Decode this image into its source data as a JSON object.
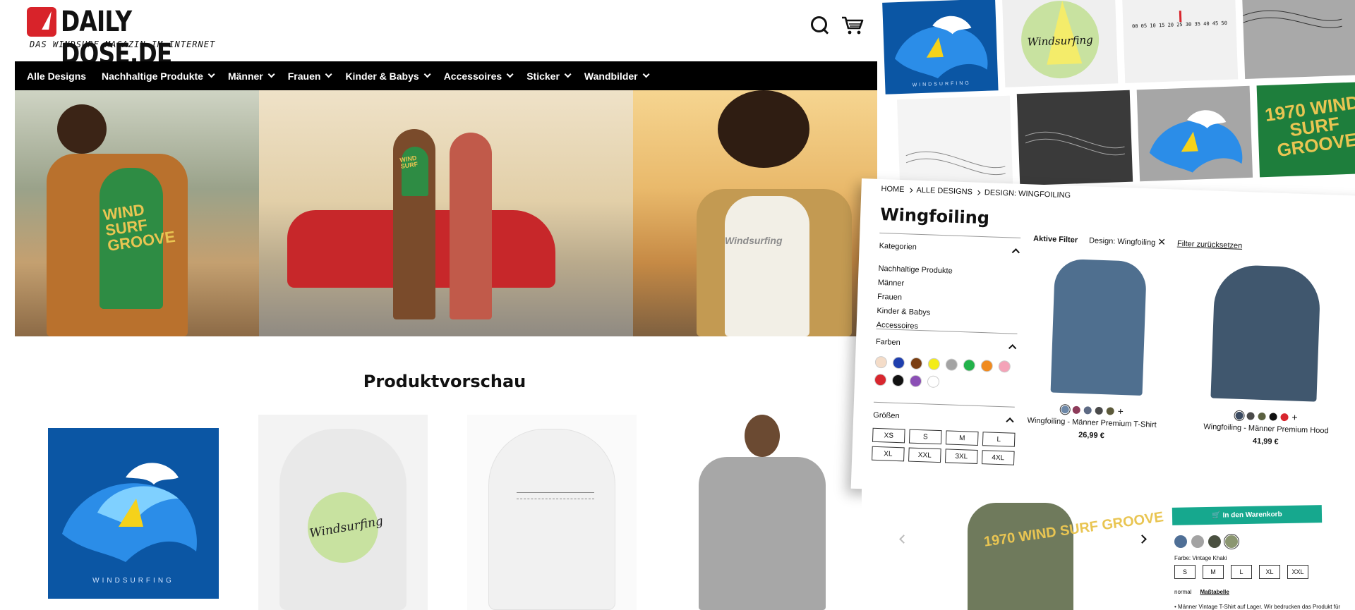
{
  "header": {
    "logo_text": "DAILY DOSE.DE",
    "logo_sub": "DAS WINDSURF MAGAZIN IM INTERNET",
    "search_icon": "search-icon",
    "cart_icon": "cart-icon"
  },
  "nav": {
    "items": [
      {
        "label": "Alle Designs",
        "dropdown": false
      },
      {
        "label": "Nachhaltige Produkte",
        "dropdown": true
      },
      {
        "label": "Männer",
        "dropdown": true
      },
      {
        "label": "Frauen",
        "dropdown": true
      },
      {
        "label": "Kinder & Babys",
        "dropdown": true
      },
      {
        "label": "Accessoires",
        "dropdown": true
      },
      {
        "label": "Sticker",
        "dropdown": true
      },
      {
        "label": "Wandbilder",
        "dropdown": true
      }
    ]
  },
  "hero": {
    "panel1_caption": "WIND SURF GROOVE",
    "panel2_caption": "WIND SURF",
    "panel3_caption": "Windsurfing"
  },
  "preview": {
    "title": "Produktvorschau",
    "card1_label": "WINDSURFING",
    "card2_label": "Windsurfing"
  },
  "collage": {
    "tile1_label": "WINDSURFING",
    "tile2_label": "Windsurfing",
    "tile3_label": "00 05 10 15 20 25 30 35 40 45 50",
    "tile8_label": "1970 WIND SURF GROOVE"
  },
  "shop": {
    "breadcrumb": [
      "HOME",
      "ALLE DESIGNS",
      "DESIGN: WINGFOILING"
    ],
    "title": "Wingfoiling",
    "facets": {
      "categories": {
        "label": "Kategorien",
        "items": [
          "Nachhaltige Produkte",
          "Männer",
          "Frauen",
          "Kinder & Babys",
          "Accessoires"
        ]
      },
      "colors": {
        "label": "Farben",
        "values": [
          "#f4dcc8",
          "#1f3fae",
          "#7a3e12",
          "#f3ec19",
          "#a3a3a3",
          "#22b24a",
          "#f08a1e",
          "#f4a3b8",
          "#d8262e",
          "#111111",
          "#8b4fb5",
          "#ffffff"
        ]
      },
      "sizes": {
        "label": "Größen",
        "values": [
          "XS",
          "S",
          "M",
          "L",
          "XL",
          "XXL",
          "3XL",
          "4XL"
        ]
      }
    },
    "active_filters": {
      "label": "Aktive Filter",
      "value": "Design: Wingfoiling",
      "reset": "Filter zurücksetzen"
    },
    "products": [
      {
        "name": "Wingfoiling - Männer Premium T-Shirt",
        "price": "26,99 €",
        "swatches": [
          "#6d88a8",
          "#8d3b5a",
          "#5d6a84",
          "#4a4a4a",
          "#5c5a3a"
        ]
      },
      {
        "name": "Wingfoiling - Männer Premium Hood",
        "price": "41,99 €",
        "swatches": [
          "#3b4a60",
          "#4a4a4a",
          "#5a6040",
          "#111111",
          "#d8262e"
        ]
      }
    ]
  },
  "detail": {
    "tee_label": "1970 WIND SURF GROOVE",
    "cart_button": "In den Warenkorb",
    "swatches": [
      "#4f6f96",
      "#a3a3a3",
      "#4a5040",
      "#8b9670"
    ],
    "color_label": "Farbe: Vintage Khaki",
    "sizes": [
      "S",
      "M",
      "L",
      "XL",
      "XXL"
    ],
    "fit": "normal",
    "size_table": "Maßtabelle",
    "note": "• Männer Vintage T-Shirt auf Lager. Wir bedrucken das Produkt für"
  }
}
